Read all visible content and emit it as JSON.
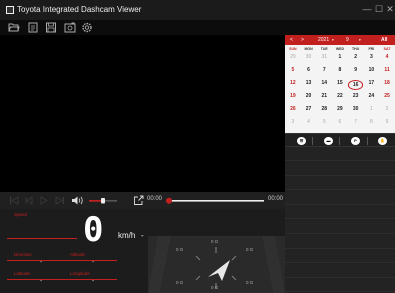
{
  "window": {
    "title": "Toyota Integrated Dashcam Viewer",
    "minimize_glyph": "—",
    "maximize_glyph": "☐",
    "close_glyph": "✕"
  },
  "toolbar": {
    "icons": [
      "open-folder-icon",
      "open-file-icon",
      "save-icon",
      "screenshot-icon",
      "settings-icon"
    ]
  },
  "player": {
    "current_time": "00:00",
    "total_time": "00:00",
    "volume_level": 0.5,
    "progress": 0.0
  },
  "dashboard": {
    "speed_label": "Speed",
    "speed_value": "0",
    "speed_unit": "km/h",
    "speed_unit_suffix": "-",
    "direction_label": "Direction",
    "direction_value": "-",
    "altitude_label": "Altitude",
    "altitude_value": "-",
    "latitude_label": "Latitude",
    "latitude_value": "-",
    "longitude_label": "Longitude",
    "longitude_value": "-",
    "gsensor": {
      "left_top": "0 G",
      "left_bottom": "0 G",
      "right_top": "0 G",
      "right_bottom": "0 G",
      "top": "0 G",
      "bottom": "0 G"
    }
  },
  "calendar": {
    "prev": "<",
    "next": ">",
    "year": "2021",
    "year_caret": "▾",
    "month": "9",
    "month_caret": "▾",
    "all_label": "All",
    "weekdays": [
      "SUN",
      "MON",
      "TUE",
      "WED",
      "THU",
      "FRI",
      "SAT"
    ],
    "weeks": [
      [
        "29",
        "30",
        "31",
        "1",
        "2",
        "3",
        "4"
      ],
      [
        "5",
        "6",
        "7",
        "8",
        "9",
        "10",
        "11"
      ],
      [
        "12",
        "13",
        "14",
        "15",
        "16",
        "17",
        "18"
      ],
      [
        "19",
        "20",
        "21",
        "22",
        "23",
        "24",
        "25"
      ],
      [
        "26",
        "27",
        "28",
        "29",
        "30",
        "1",
        "2"
      ],
      [
        "3",
        "4",
        "5",
        "6",
        "7",
        "8",
        "9"
      ]
    ],
    "today": "16"
  },
  "filters": [
    "all-recording-filter-icon",
    "event-recording-filter-icon",
    "parking-recording-filter-icon",
    "manual-recording-filter-icon"
  ]
}
